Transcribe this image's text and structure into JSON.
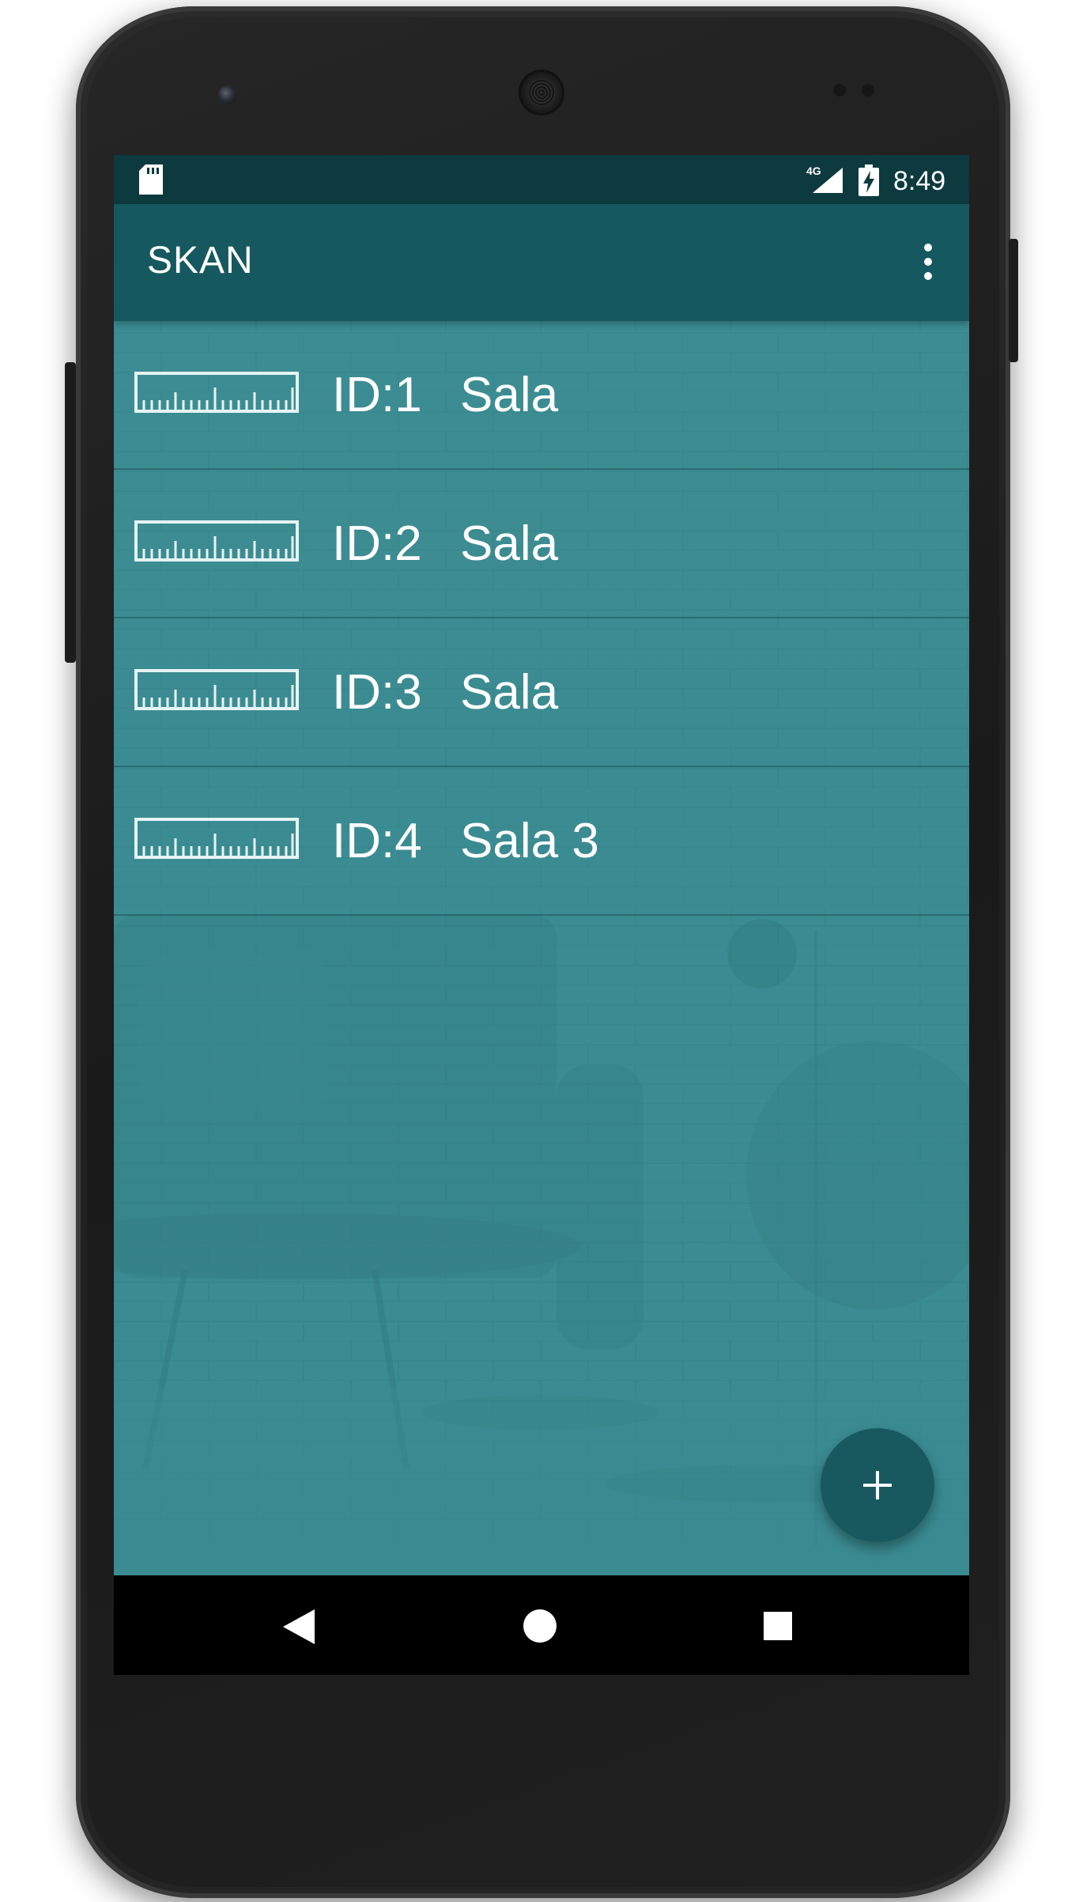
{
  "status_bar": {
    "network": "4G",
    "time": "8:49",
    "icons": [
      "sd-card-icon",
      "signal-icon",
      "battery-charging-icon"
    ]
  },
  "app_bar": {
    "title": "SKAN",
    "menu_icon": "overflow-menu-icon"
  },
  "items": [
    {
      "id_label": "ID:1",
      "name": "Sala",
      "icon": "ruler-icon"
    },
    {
      "id_label": "ID:2",
      "name": "Sala",
      "icon": "ruler-icon"
    },
    {
      "id_label": "ID:3",
      "name": "Sala",
      "icon": "ruler-icon"
    },
    {
      "id_label": "ID:4",
      "name": "Sala 3",
      "icon": "ruler-icon"
    }
  ],
  "fab": {
    "icon": "plus-icon"
  },
  "nav": {
    "icons": [
      "back-icon",
      "home-icon",
      "recents-icon"
    ]
  },
  "colors": {
    "status_bar": "#0d3a3e",
    "app_bar": "#16585f",
    "background": "#3a8a90",
    "fab": "#17595f"
  }
}
